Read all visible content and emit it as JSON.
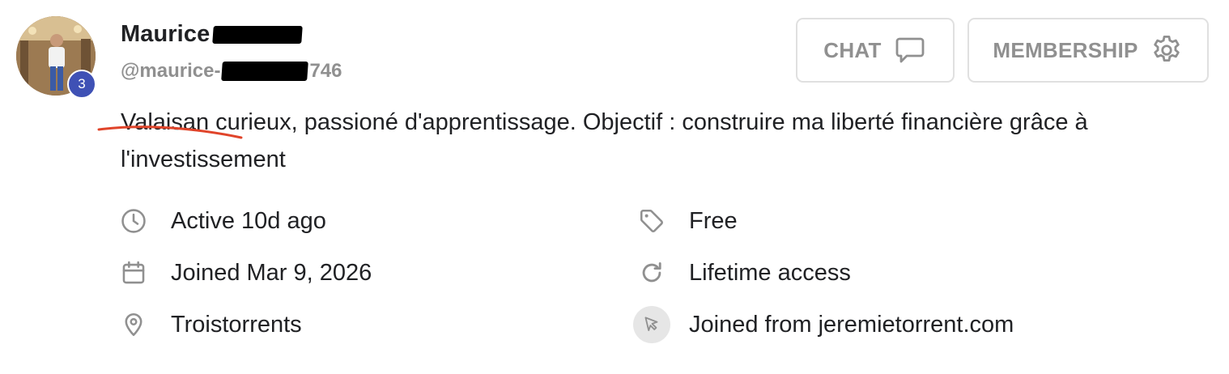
{
  "profile": {
    "first_name": "Maurice",
    "handle_prefix": "@maurice-",
    "handle_suffix": "746",
    "level": "3",
    "bio": "Valaisan curieux, passioné d'apprentissage. Objectif : construire ma liberté financière grâce à l'investissement"
  },
  "actions": {
    "chat_label": "CHAT",
    "membership_label": "MEMBERSHIP"
  },
  "details": {
    "activity": "Active 10d ago",
    "joined": "Joined Mar 9, 2026",
    "location": "Troistorrents",
    "price": "Free",
    "access": "Lifetime access",
    "source": "Joined from jeremietorrent.com"
  },
  "icons": {
    "chat": "chat-bubble-icon",
    "membership": "gear-icon",
    "activity": "clock-icon",
    "joined": "calendar-icon",
    "location": "map-pin-icon",
    "price": "tag-icon",
    "access": "refresh-icon",
    "source": "cursor-pointer-icon"
  },
  "colors": {
    "level_badge": "#3f51b5",
    "muted_text": "#909090",
    "icon": "#909090",
    "annotation": "#e0442a"
  }
}
